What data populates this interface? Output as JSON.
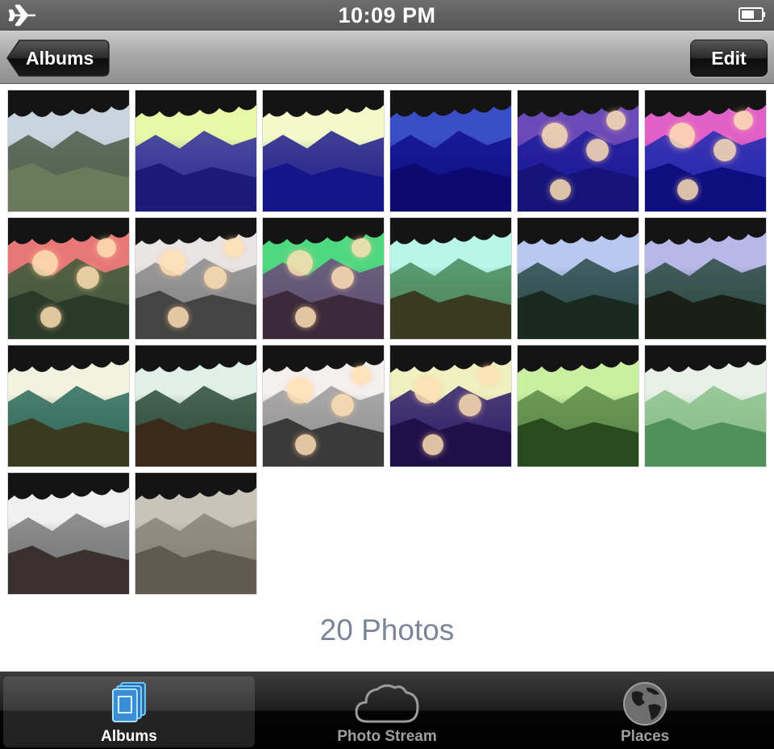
{
  "status": {
    "time": "10:09 PM",
    "airplane_icon": "airplane-icon",
    "battery_icon": "battery-icon"
  },
  "nav": {
    "back_label": "Albums",
    "edit_label": "Edit"
  },
  "photos": {
    "count_text": "20 Photos",
    "thumbs": [
      {
        "sky": "#c8d4de",
        "hill": "#4a5a48",
        "tint": "#6a7a5a",
        "bokeh": false
      },
      {
        "sky": "#e8f7a8",
        "hill": "#2a2a9a",
        "tint": "#1b1b7a",
        "bokeh": false
      },
      {
        "sky": "#f3f9c8",
        "hill": "#1c1c8a",
        "tint": "#15158a",
        "bokeh": false
      },
      {
        "sky": "#3a4ec8",
        "hill": "#10108a",
        "tint": "#0a0a70",
        "bokeh": false
      },
      {
        "sky": "#6a4ab8",
        "hill": "#1a1a9a",
        "tint": "#14147a",
        "bokeh": true
      },
      {
        "sky": "#e060c8",
        "hill": "#1c2ab0",
        "tint": "#0e0e80",
        "bokeh": true
      },
      {
        "sky": "#e87878",
        "hill": "#3a5a3a",
        "tint": "#2a3a28",
        "bokeh": true
      },
      {
        "sky": "#e9e4e4",
        "hill": "#8a8a8a",
        "tint": "#444444",
        "bokeh": true
      },
      {
        "sky": "#50d880",
        "hill": "#6a4a7a",
        "tint": "#3a2a3a",
        "bokeh": true
      },
      {
        "sky": "#b8f6e8",
        "hill": "#4a8a5a",
        "tint": "#3a3a20",
        "bokeh": false
      },
      {
        "sky": "#b8c8f0",
        "hill": "#2a4a48",
        "tint": "#1a2a20",
        "bokeh": false
      },
      {
        "sky": "#b8b8e8",
        "hill": "#2a4a40",
        "tint": "#1a2018",
        "bokeh": false
      },
      {
        "sky": "#f2f2e0",
        "hill": "#2a6a5a",
        "tint": "#3a3a20",
        "bokeh": false
      },
      {
        "sky": "#e0f0e8",
        "hill": "#2a4a3a",
        "tint": "#3a2a1a",
        "bokeh": false
      },
      {
        "sky": "#f4f0f0",
        "hill": "#9a9a9a",
        "tint": "#3a3a3a",
        "bokeh": true
      },
      {
        "sky": "#f0f0c0",
        "hill": "#2a1a6a",
        "tint": "#20104a",
        "bokeh": true
      },
      {
        "sky": "#c8f0a0",
        "hill": "#5a8a48",
        "tint": "#2a4a20",
        "bokeh": false
      },
      {
        "sky": "#e8f0e8",
        "hill": "#8ac08a",
        "tint": "#50905a",
        "bokeh": false
      },
      {
        "sky": "#f0f0f0",
        "hill": "#7a7a7a",
        "tint": "#3a3030",
        "bokeh": false
      },
      {
        "sky": "#c8c4b8",
        "hill": "#8a8478",
        "tint": "#605a50",
        "bokeh": false
      }
    ]
  },
  "tabs": [
    {
      "label": "Albums",
      "icon": "albums-icon",
      "selected": true
    },
    {
      "label": "Photo Stream",
      "icon": "cloud-icon",
      "selected": false
    },
    {
      "label": "Places",
      "icon": "globe-icon",
      "selected": false
    }
  ]
}
